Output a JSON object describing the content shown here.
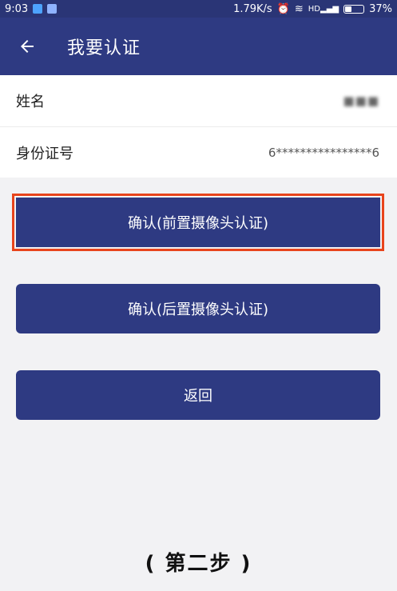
{
  "status_bar": {
    "time": "9:03",
    "network_speed": "1.79K/s",
    "signal_badge": "HD",
    "battery": "37%"
  },
  "app_bar": {
    "back_icon": "arrow-left-icon",
    "title": "我要认证"
  },
  "info": {
    "name_label": "姓名",
    "name_value": "■■■",
    "id_label": "身份证号",
    "id_value": "6****************6"
  },
  "buttons": {
    "front_camera": "确认(前置摄像头认证)",
    "rear_camera": "确认(后置摄像头认证)",
    "back": "返回"
  },
  "caption": "( 第二步 )",
  "colors": {
    "primary": "#2e3a82",
    "highlight": "#e8441c",
    "background": "#f2f2f4"
  }
}
